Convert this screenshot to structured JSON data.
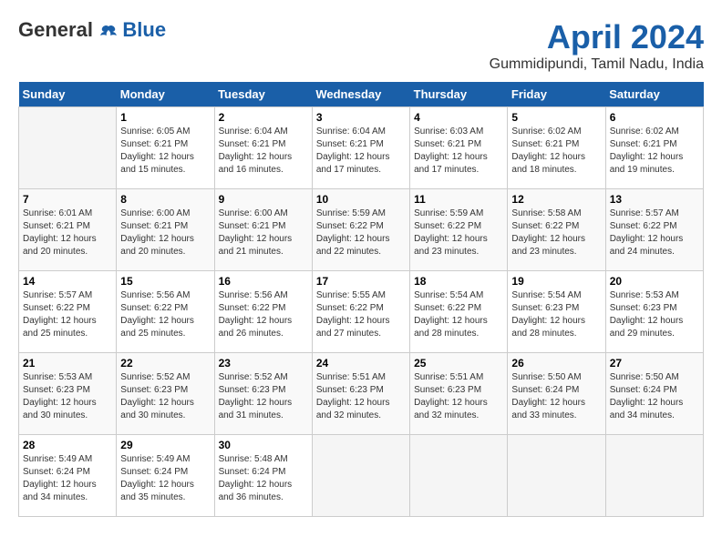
{
  "header": {
    "logo": {
      "general": "General",
      "blue": "Blue"
    },
    "title": "April 2024",
    "location": "Gummidipundi, Tamil Nadu, India"
  },
  "calendar": {
    "days_of_week": [
      "Sunday",
      "Monday",
      "Tuesday",
      "Wednesday",
      "Thursday",
      "Friday",
      "Saturday"
    ],
    "weeks": [
      [
        {
          "day": "",
          "sunrise": "",
          "sunset": "",
          "daylight": ""
        },
        {
          "day": "1",
          "sunrise": "Sunrise: 6:05 AM",
          "sunset": "Sunset: 6:21 PM",
          "daylight": "Daylight: 12 hours and 15 minutes."
        },
        {
          "day": "2",
          "sunrise": "Sunrise: 6:04 AM",
          "sunset": "Sunset: 6:21 PM",
          "daylight": "Daylight: 12 hours and 16 minutes."
        },
        {
          "day": "3",
          "sunrise": "Sunrise: 6:04 AM",
          "sunset": "Sunset: 6:21 PM",
          "daylight": "Daylight: 12 hours and 17 minutes."
        },
        {
          "day": "4",
          "sunrise": "Sunrise: 6:03 AM",
          "sunset": "Sunset: 6:21 PM",
          "daylight": "Daylight: 12 hours and 17 minutes."
        },
        {
          "day": "5",
          "sunrise": "Sunrise: 6:02 AM",
          "sunset": "Sunset: 6:21 PM",
          "daylight": "Daylight: 12 hours and 18 minutes."
        },
        {
          "day": "6",
          "sunrise": "Sunrise: 6:02 AM",
          "sunset": "Sunset: 6:21 PM",
          "daylight": "Daylight: 12 hours and 19 minutes."
        }
      ],
      [
        {
          "day": "7",
          "sunrise": "Sunrise: 6:01 AM",
          "sunset": "Sunset: 6:21 PM",
          "daylight": "Daylight: 12 hours and 20 minutes."
        },
        {
          "day": "8",
          "sunrise": "Sunrise: 6:00 AM",
          "sunset": "Sunset: 6:21 PM",
          "daylight": "Daylight: 12 hours and 20 minutes."
        },
        {
          "day": "9",
          "sunrise": "Sunrise: 6:00 AM",
          "sunset": "Sunset: 6:21 PM",
          "daylight": "Daylight: 12 hours and 21 minutes."
        },
        {
          "day": "10",
          "sunrise": "Sunrise: 5:59 AM",
          "sunset": "Sunset: 6:22 PM",
          "daylight": "Daylight: 12 hours and 22 minutes."
        },
        {
          "day": "11",
          "sunrise": "Sunrise: 5:59 AM",
          "sunset": "Sunset: 6:22 PM",
          "daylight": "Daylight: 12 hours and 23 minutes."
        },
        {
          "day": "12",
          "sunrise": "Sunrise: 5:58 AM",
          "sunset": "Sunset: 6:22 PM",
          "daylight": "Daylight: 12 hours and 23 minutes."
        },
        {
          "day": "13",
          "sunrise": "Sunrise: 5:57 AM",
          "sunset": "Sunset: 6:22 PM",
          "daylight": "Daylight: 12 hours and 24 minutes."
        }
      ],
      [
        {
          "day": "14",
          "sunrise": "Sunrise: 5:57 AM",
          "sunset": "Sunset: 6:22 PM",
          "daylight": "Daylight: 12 hours and 25 minutes."
        },
        {
          "day": "15",
          "sunrise": "Sunrise: 5:56 AM",
          "sunset": "Sunset: 6:22 PM",
          "daylight": "Daylight: 12 hours and 25 minutes."
        },
        {
          "day": "16",
          "sunrise": "Sunrise: 5:56 AM",
          "sunset": "Sunset: 6:22 PM",
          "daylight": "Daylight: 12 hours and 26 minutes."
        },
        {
          "day": "17",
          "sunrise": "Sunrise: 5:55 AM",
          "sunset": "Sunset: 6:22 PM",
          "daylight": "Daylight: 12 hours and 27 minutes."
        },
        {
          "day": "18",
          "sunrise": "Sunrise: 5:54 AM",
          "sunset": "Sunset: 6:22 PM",
          "daylight": "Daylight: 12 hours and 28 minutes."
        },
        {
          "day": "19",
          "sunrise": "Sunrise: 5:54 AM",
          "sunset": "Sunset: 6:23 PM",
          "daylight": "Daylight: 12 hours and 28 minutes."
        },
        {
          "day": "20",
          "sunrise": "Sunrise: 5:53 AM",
          "sunset": "Sunset: 6:23 PM",
          "daylight": "Daylight: 12 hours and 29 minutes."
        }
      ],
      [
        {
          "day": "21",
          "sunrise": "Sunrise: 5:53 AM",
          "sunset": "Sunset: 6:23 PM",
          "daylight": "Daylight: 12 hours and 30 minutes."
        },
        {
          "day": "22",
          "sunrise": "Sunrise: 5:52 AM",
          "sunset": "Sunset: 6:23 PM",
          "daylight": "Daylight: 12 hours and 30 minutes."
        },
        {
          "day": "23",
          "sunrise": "Sunrise: 5:52 AM",
          "sunset": "Sunset: 6:23 PM",
          "daylight": "Daylight: 12 hours and 31 minutes."
        },
        {
          "day": "24",
          "sunrise": "Sunrise: 5:51 AM",
          "sunset": "Sunset: 6:23 PM",
          "daylight": "Daylight: 12 hours and 32 minutes."
        },
        {
          "day": "25",
          "sunrise": "Sunrise: 5:51 AM",
          "sunset": "Sunset: 6:23 PM",
          "daylight": "Daylight: 12 hours and 32 minutes."
        },
        {
          "day": "26",
          "sunrise": "Sunrise: 5:50 AM",
          "sunset": "Sunset: 6:24 PM",
          "daylight": "Daylight: 12 hours and 33 minutes."
        },
        {
          "day": "27",
          "sunrise": "Sunrise: 5:50 AM",
          "sunset": "Sunset: 6:24 PM",
          "daylight": "Daylight: 12 hours and 34 minutes."
        }
      ],
      [
        {
          "day": "28",
          "sunrise": "Sunrise: 5:49 AM",
          "sunset": "Sunset: 6:24 PM",
          "daylight": "Daylight: 12 hours and 34 minutes."
        },
        {
          "day": "29",
          "sunrise": "Sunrise: 5:49 AM",
          "sunset": "Sunset: 6:24 PM",
          "daylight": "Daylight: 12 hours and 35 minutes."
        },
        {
          "day": "30",
          "sunrise": "Sunrise: 5:48 AM",
          "sunset": "Sunset: 6:24 PM",
          "daylight": "Daylight: 12 hours and 36 minutes."
        },
        {
          "day": "",
          "sunrise": "",
          "sunset": "",
          "daylight": ""
        },
        {
          "day": "",
          "sunrise": "",
          "sunset": "",
          "daylight": ""
        },
        {
          "day": "",
          "sunrise": "",
          "sunset": "",
          "daylight": ""
        },
        {
          "day": "",
          "sunrise": "",
          "sunset": "",
          "daylight": ""
        }
      ]
    ]
  }
}
